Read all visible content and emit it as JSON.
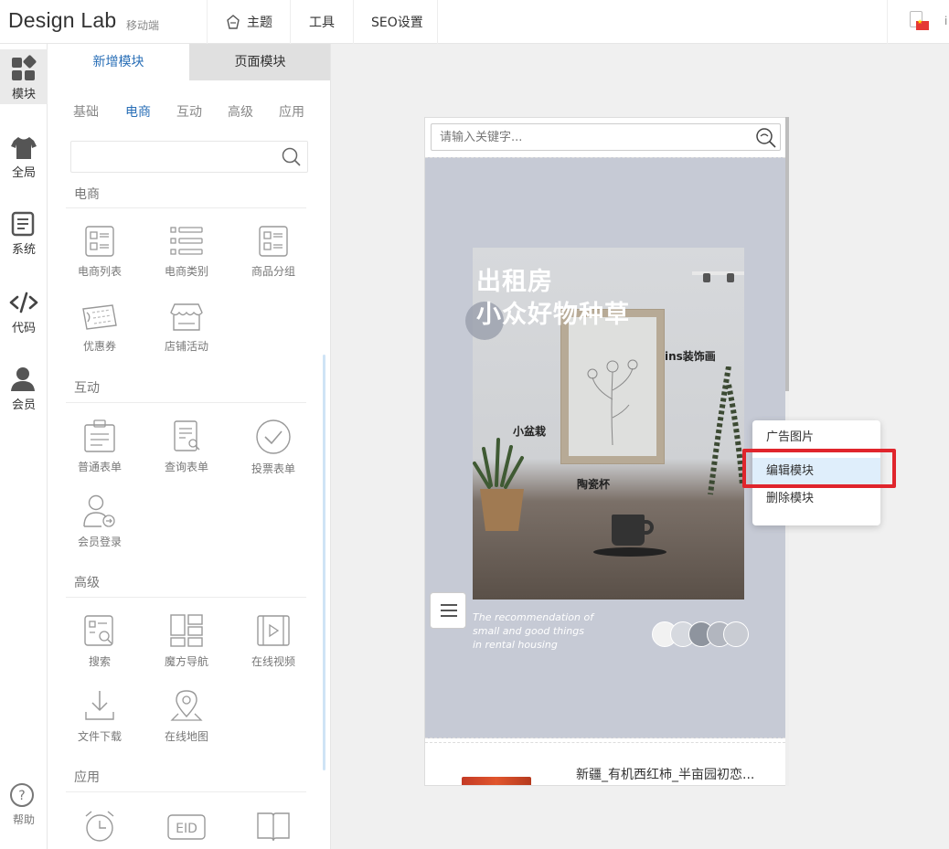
{
  "app": {
    "brand": "Design Lab",
    "mobile_label": "移动端"
  },
  "topnav": {
    "theme": "主题",
    "tools": "工具",
    "seo": "SEO设置",
    "lang_initial": "i"
  },
  "rail": [
    {
      "label": "模块",
      "icon": "modules-icon"
    },
    {
      "label": "全局",
      "icon": "shirt-icon"
    },
    {
      "label": "系统",
      "icon": "document-icon"
    },
    {
      "label": "代码",
      "icon": "code-icon"
    },
    {
      "label": "会员",
      "icon": "user-icon"
    },
    {
      "label": "帮助",
      "icon": "help-icon"
    }
  ],
  "panel": {
    "tabs": [
      "新增模块",
      "页面模块"
    ],
    "categories": [
      "基础",
      "电商",
      "互动",
      "高级",
      "应用"
    ],
    "sections": {
      "ecommerce": {
        "title": "电商",
        "items": [
          "电商列表",
          "电商类别",
          "商品分组",
          "优惠券",
          "店铺活动"
        ]
      },
      "interactive": {
        "title": "互动",
        "items": [
          "普通表单",
          "查询表单",
          "投票表单",
          "会员登录"
        ]
      },
      "advanced": {
        "title": "高级",
        "items": [
          "搜索",
          "魔方导航",
          "在线视频",
          "文件下载",
          "在线地图"
        ]
      },
      "apps": {
        "title": "应用",
        "items": [
          "",
          "EID",
          ""
        ]
      }
    }
  },
  "canvas": {
    "search_placeholder": "请输入关键字...",
    "banner": {
      "title_line1": "出租房",
      "title_line2": "小众好物种草",
      "tag_decor": "ins装饰画",
      "tag_pot": "小盆栽",
      "tag_cup": "陶瓷杯",
      "eng_line1": "The recommendation of",
      "eng_line2": "small and good things",
      "eng_line3": "in rental housing",
      "swatches": [
        "#f1f1f1",
        "#d6d9df",
        "#8e949e",
        "#b2b6bf",
        "#c9ccd3"
      ]
    },
    "product_name": "新疆_有机西红柿_半亩园初恋..."
  },
  "context_menu": {
    "items": [
      "广告图片",
      "编辑模块",
      "删除模块"
    ],
    "highlighted": "编辑模块"
  },
  "colors": {
    "accent": "#2a6fb7",
    "highlight_box": "#e0252c"
  }
}
